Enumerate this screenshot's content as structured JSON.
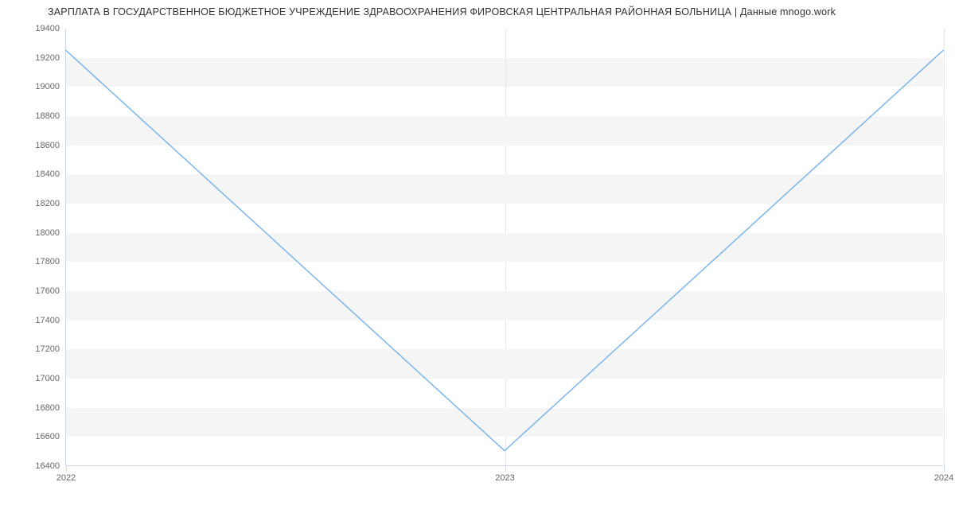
{
  "chart_data": {
    "type": "line",
    "title": "ЗАРПЛАТА В ГОСУДАРСТВЕННОЕ БЮДЖЕТНОЕ УЧРЕЖДЕНИЕ ЗДРАВООХРАНЕНИЯ ФИРОВСКАЯ ЦЕНТРАЛЬНАЯ РАЙОННАЯ БОЛЬНИЦА | Данные mnogo.work",
    "xlabel": "",
    "ylabel": "",
    "x": [
      "2022",
      "2023",
      "2024"
    ],
    "values": [
      19250,
      16500,
      19250
    ],
    "ylim": [
      16400,
      19400
    ],
    "y_ticks": [
      16400,
      16600,
      16800,
      17000,
      17200,
      17400,
      17600,
      17800,
      18000,
      18200,
      18400,
      18600,
      18800,
      19000,
      19200,
      19400
    ],
    "x_ticks": [
      "2022",
      "2023",
      "2024"
    ],
    "line_color": "#7cb5ec"
  }
}
